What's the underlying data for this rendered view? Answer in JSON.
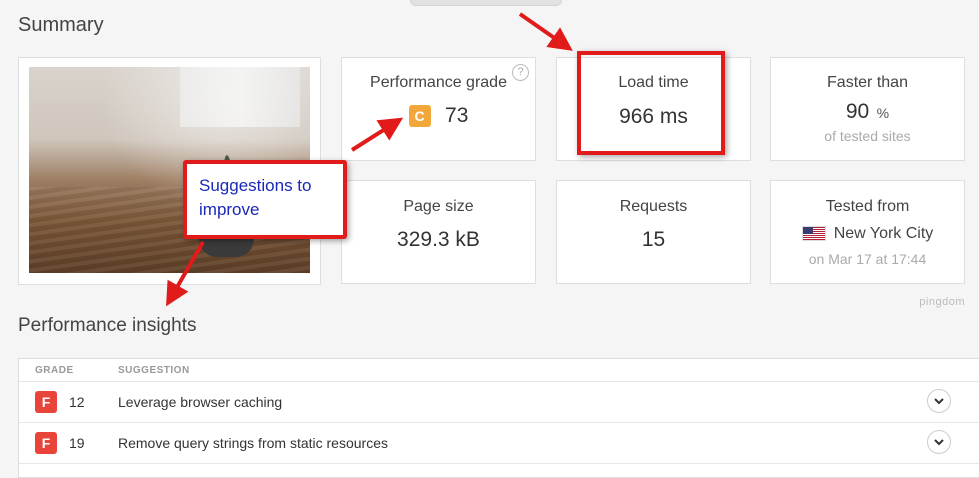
{
  "summary": {
    "title": "Summary",
    "performance_grade": {
      "label": "Performance grade",
      "grade": "C",
      "score": "73",
      "help": "?"
    },
    "load_time": {
      "label": "Load time",
      "value": "966 ms"
    },
    "faster_than": {
      "label": "Faster than",
      "value": "90",
      "unit": "%",
      "sub": "of tested sites"
    },
    "page_size": {
      "label": "Page size",
      "value": "329.3 kB"
    },
    "requests": {
      "label": "Requests",
      "value": "15"
    },
    "tested_from": {
      "label": "Tested from",
      "location": "New York City",
      "date": "on Mar 17 at 17:44",
      "flag_icon": "us-flag-icon"
    }
  },
  "annotation": {
    "callout_text": "Suggestions to improve",
    "color": "#e11a1a"
  },
  "watermark": "pingdom",
  "insights": {
    "title": "Performance insights",
    "columns": {
      "grade": "GRADE",
      "suggestion": "SUGGESTION"
    },
    "rows": [
      {
        "grade": "F",
        "score": "12",
        "suggestion": "Leverage browser caching"
      },
      {
        "grade": "F",
        "score": "19",
        "suggestion": "Remove query strings from static resources"
      }
    ]
  },
  "colors": {
    "grade_c": "#f2a73a",
    "grade_f": "#e8443a",
    "highlight": "#e11a1a",
    "callout_text": "#1a28b8"
  }
}
